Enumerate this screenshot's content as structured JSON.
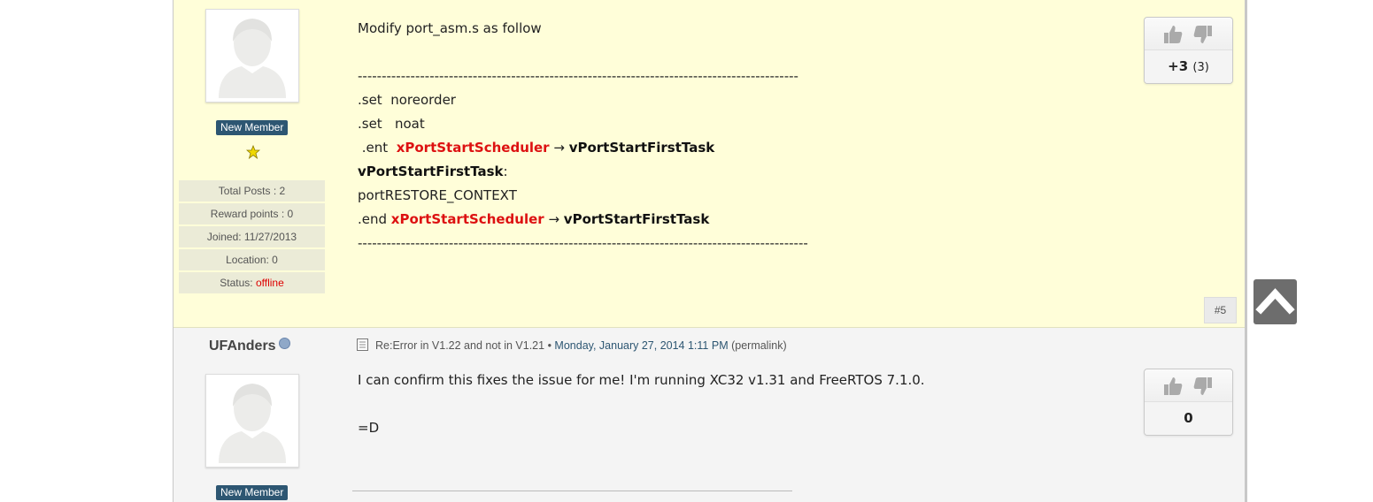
{
  "post1": {
    "rank": "New Member",
    "stats": [
      {
        "label": "Total Posts : ",
        "value": "2"
      },
      {
        "label": "Reward points : ",
        "value": "0"
      },
      {
        "label": "Joined: ",
        "value": "11/27/2013"
      },
      {
        "label": "Location: ",
        "value": "0"
      },
      {
        "label": "Status: ",
        "value": "offline"
      }
    ],
    "lines": {
      "l1": "Modify port_asm.s as follow",
      "dashes1": "--------------------------------------------------------------------------------------------",
      "l3": ".set  noreorder",
      "l4": ".set   noat",
      "l5_prefix": " .ent  ",
      "l5_red": "xPortStartScheduler",
      "l5_arrow": " → ",
      "l5_bold": "vPortStartFirstTask",
      "l6_bold": "vPortStartFirstTask",
      "l6_colon": ":",
      "l7": "portRESTORE_CONTEXT",
      "l8_prefix": ".end ",
      "l8_red": "xPortStartScheduler",
      "l8_arrow": " → ",
      "l8_bold": "vPortStartFirstTask",
      "dashes2": "----------------------------------------------------------------------------------------------"
    },
    "vote": {
      "score": "+3",
      "count": "(3)"
    },
    "post_number": "#5"
  },
  "post2": {
    "username": "UFAnders",
    "rank": "New Member",
    "header": {
      "subject": "Re:Error in V1.22 and not in V1.21",
      "bullet": " • ",
      "date": "Monday, January 27, 2014 1:11 PM",
      "permalink": "(permalink)"
    },
    "lines": {
      "l1": "I can confirm this fixes the issue for me! I'm running XC32 v1.31 and FreeRTOS 7.1.0.",
      "l2": "=D"
    },
    "vote": {
      "score": "0"
    }
  },
  "colors": {
    "post_highlight_bg": "#fffed9",
    "post_bg": "#f4f4f4",
    "rank_badge": "#2d5672",
    "function_red": "#dd1111",
    "offline_red": "#dd0000",
    "back_to_top": "#6d6d6d"
  },
  "icons": {
    "thumbs_up": "thumbs-up-icon",
    "thumbs_down": "thumbs-down-icon",
    "star": "star-icon",
    "document": "document-icon",
    "online_status": "online-status-icon",
    "back_to_top": "chevron-up-icon"
  }
}
